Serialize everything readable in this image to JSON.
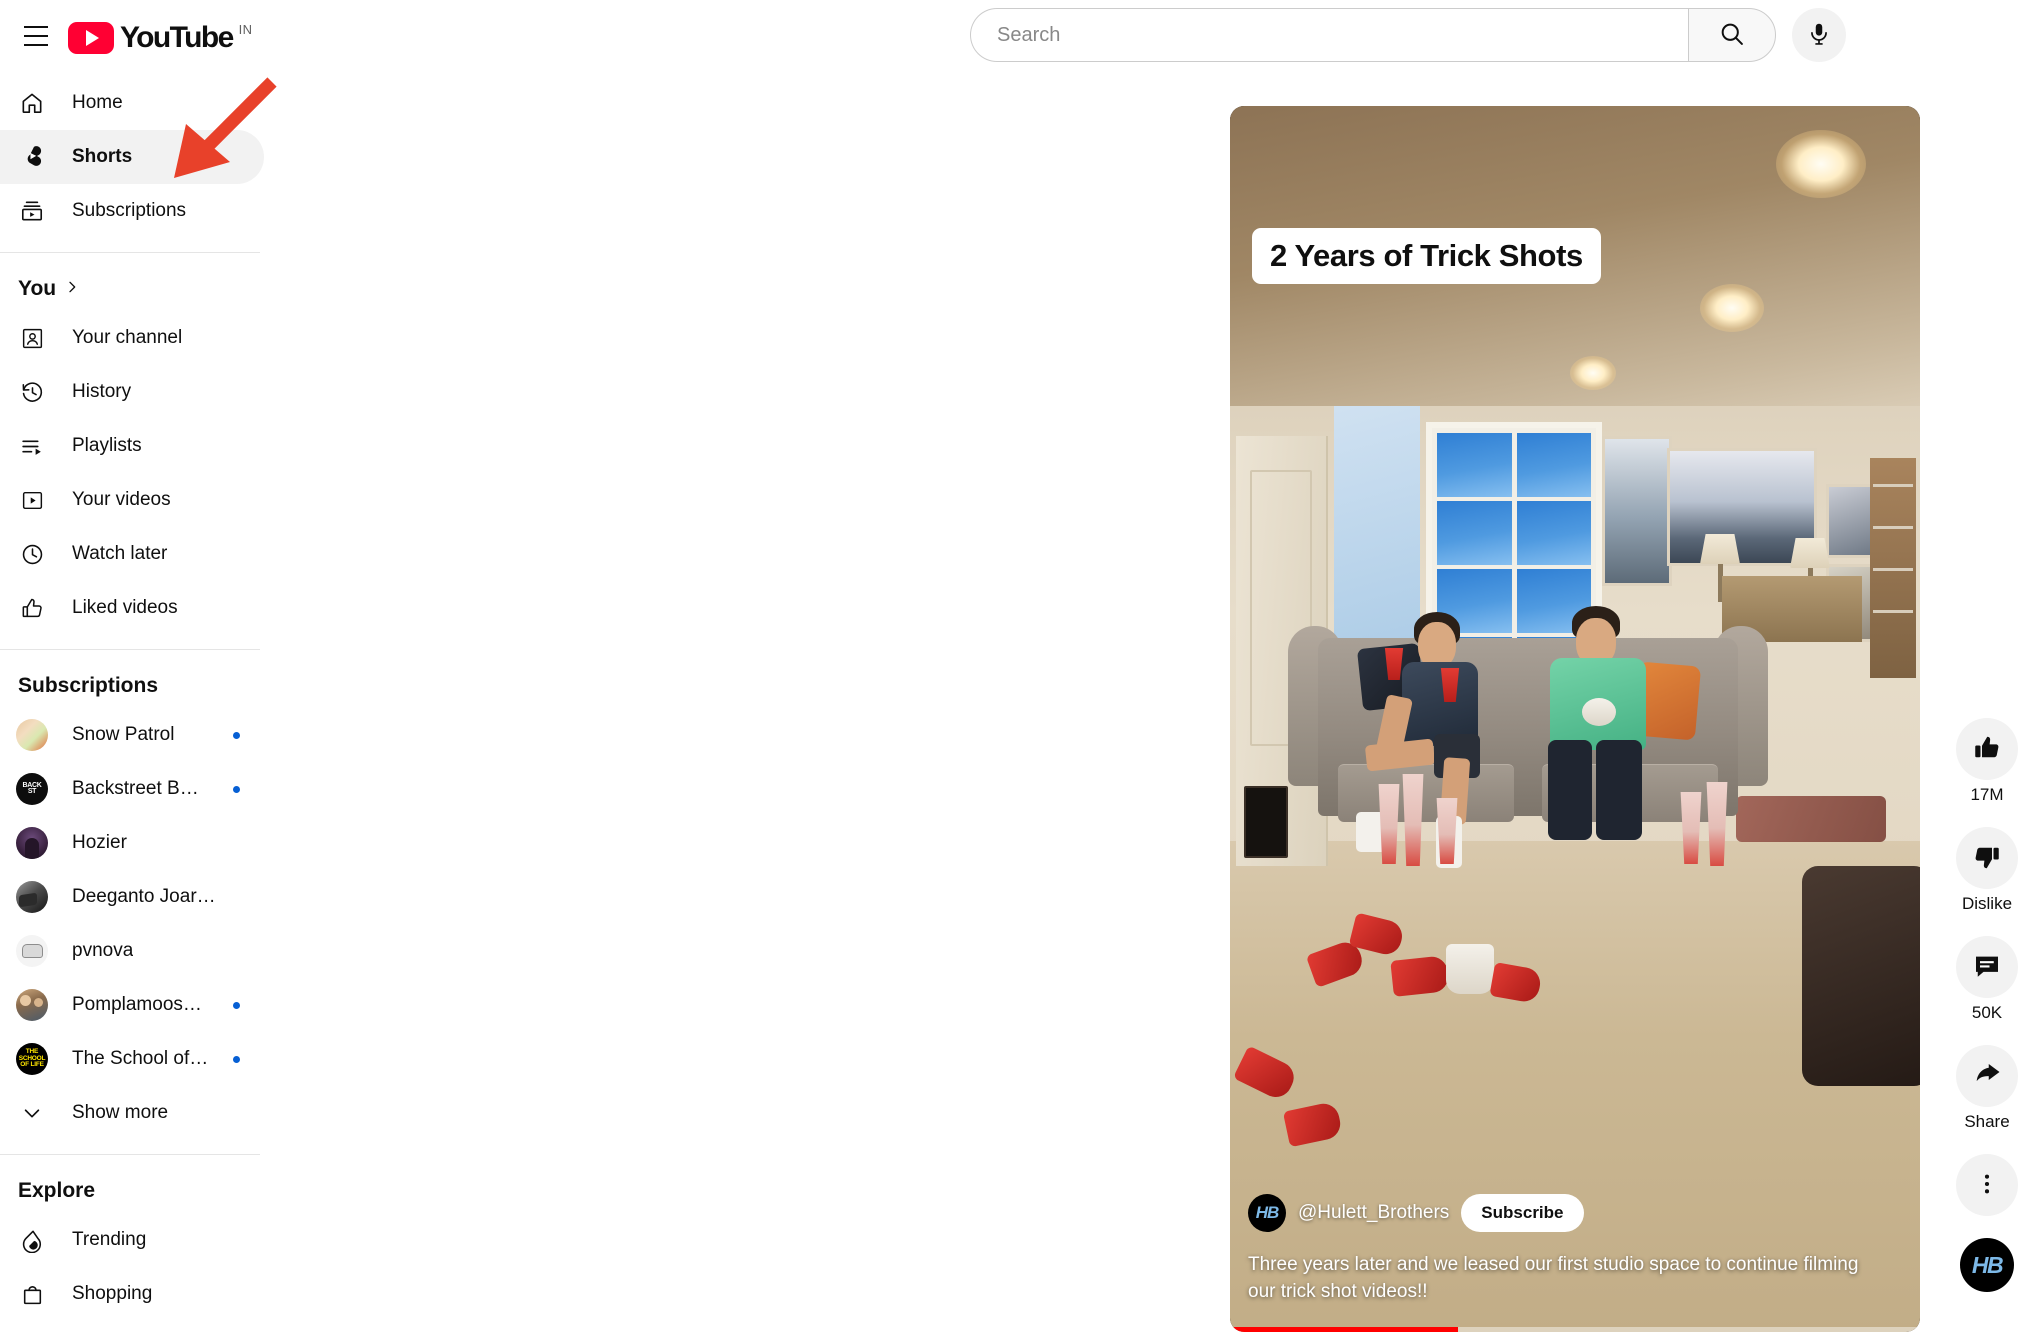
{
  "topbar": {
    "menu_icon": "hamburger-icon",
    "logo_text": "YouTube",
    "logo_country": "IN",
    "logo_icon": "youtube-play-icon"
  },
  "search": {
    "placeholder": "Search",
    "value": "",
    "search_icon": "search-icon",
    "mic_icon": "microphone-icon"
  },
  "sidebar": {
    "primary": [
      {
        "label": "Home",
        "icon": "home-icon",
        "active": false
      },
      {
        "label": "Shorts",
        "icon": "shorts-icon",
        "active": true
      },
      {
        "label": "Subscriptions",
        "icon": "subscriptions-icon",
        "active": false
      }
    ],
    "you": {
      "title": "You",
      "chevron_icon": "chevron-right-icon",
      "items": [
        {
          "label": "Your channel",
          "icon": "your-channel-icon"
        },
        {
          "label": "History",
          "icon": "history-icon"
        },
        {
          "label": "Playlists",
          "icon": "playlists-icon"
        },
        {
          "label": "Your videos",
          "icon": "your-videos-icon"
        },
        {
          "label": "Watch later",
          "icon": "watch-later-icon"
        },
        {
          "label": "Liked videos",
          "icon": "liked-videos-icon"
        }
      ]
    },
    "subscriptions": {
      "title": "Subscriptions",
      "channels": [
        {
          "name": "Snow Patrol",
          "has_new": true,
          "avatar": "av-snow"
        },
        {
          "name": "Backstreet Boys",
          "has_new": true,
          "avatar": "av-bsb"
        },
        {
          "name": "Hozier",
          "has_new": false,
          "avatar": "av-hozier"
        },
        {
          "name": "Deeganto Joardar",
          "has_new": false,
          "avatar": "av-deeganto"
        },
        {
          "name": "pvnova",
          "has_new": false,
          "avatar": "av-pvnova"
        },
        {
          "name": "PomplamooseM...",
          "has_new": true,
          "avatar": "av-pomp"
        },
        {
          "name": "The School of Life",
          "has_new": true,
          "avatar": "av-school"
        }
      ],
      "show_more_label": "Show more",
      "show_more_icon": "chevron-down-icon"
    },
    "explore": {
      "title": "Explore",
      "items": [
        {
          "label": "Trending",
          "icon": "trending-icon"
        },
        {
          "label": "Shopping",
          "icon": "shopping-bag-icon"
        }
      ]
    }
  },
  "player": {
    "overlay_title": "2 Years of Trick Shots",
    "channel_handle": "@Hulett_Brothers",
    "channel_avatar_text": "HB",
    "subscribe_label": "Subscribe",
    "caption": "Three years later and we leased our first studio space to continue filming our trick shot videos!!",
    "progress_percent": 33
  },
  "actions": [
    {
      "name": "like",
      "icon": "thumbs-up-icon",
      "label": "17M"
    },
    {
      "name": "dislike",
      "icon": "thumbs-down-icon",
      "label": "Dislike"
    },
    {
      "name": "comments",
      "icon": "comment-icon",
      "label": "50K"
    },
    {
      "name": "share",
      "icon": "share-arrow-icon",
      "label": "Share"
    },
    {
      "name": "more",
      "icon": "more-vertical-icon",
      "label": ""
    }
  ],
  "rail_avatar_text": "HB",
  "annotation": {
    "type": "arrow",
    "color": "#E8412A",
    "points_to": "Shorts"
  },
  "colors": {
    "brand_red": "#ff0033",
    "progress_red": "#ff0000",
    "new_dot_blue": "#065fd4",
    "active_bg": "#f2f2f2"
  }
}
